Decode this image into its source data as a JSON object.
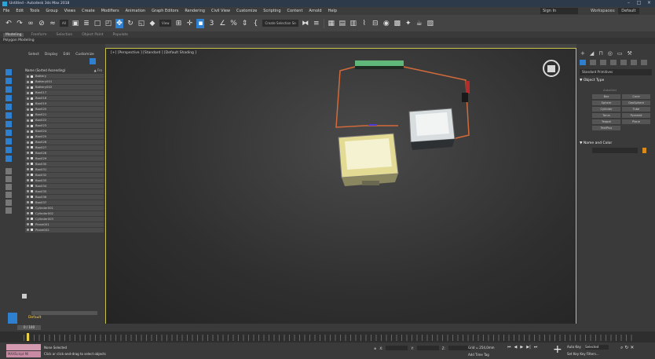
{
  "window": {
    "title": "Untitled - Autodesk 3ds Max 2018"
  },
  "menubar": {
    "items": [
      "File",
      "Edit",
      "Tools",
      "Group",
      "Views",
      "Create",
      "Modifiers",
      "Animation",
      "Graph Editors",
      "Rendering",
      "Civil View",
      "Customize",
      "Scripting",
      "Content",
      "Arnold",
      "Help"
    ],
    "signin": "Sign In",
    "workspaces_label": "Workspaces:",
    "workspaces_value": "Default"
  },
  "toolbar": {
    "filter_dd": "All",
    "view_dd": "View",
    "selection_set_dd": "Create Selection Se"
  },
  "ribbon": {
    "tabs": [
      "Modeling",
      "Freeform",
      "Selection",
      "Object Paint",
      "Populate"
    ],
    "sub_label": "Polygon Modeling"
  },
  "explorer": {
    "menu": [
      "Select",
      "Display",
      "Edit",
      "Customize"
    ],
    "header": "Name (Sorted Ascending)",
    "sort_label": "▲ Fro",
    "items": [
      "Battery",
      "Battery001",
      "Battery002",
      "Box017",
      "Box018",
      "Box019",
      "Box020",
      "Box021",
      "Box022",
      "Box023",
      "Box024",
      "Box025",
      "Box026",
      "Box027",
      "Box028",
      "Box029",
      "Box030",
      "Box031",
      "Box032",
      "Box033",
      "Box034",
      "Box035",
      "Box036",
      "Box037",
      "Cylinder001",
      "Cylinder002",
      "Cylinder003",
      "Plane001",
      "Plane002"
    ],
    "layer": "Default"
  },
  "viewport": {
    "label": "[+] [Perspective ] [Standard ] [Default Shading ]"
  },
  "command_panel": {
    "dropdown": "Standard Primitives",
    "object_type_title": "▼ Object Type",
    "autogrid": "AutoGrid",
    "primitives": [
      "Box",
      "Cone",
      "Sphere",
      "GeoSphere",
      "Cylinder",
      "Tube",
      "Torus",
      "Pyramid",
      "Teapot",
      "Plane",
      "TextPlus"
    ],
    "name_color_title": "▼ Name and Color",
    "colors": {
      "object_color": "#d88a1a"
    }
  },
  "timeline": {
    "frame": "0 / 100"
  },
  "status": {
    "selection": "None Selected",
    "prompt": "Click or click-and-drag to select objects",
    "maxscript_label": "MAXScript Mi",
    "x_label": "X:",
    "y_label": "Y:",
    "z_label": "Z:",
    "grid": "Grid = 254,0mm",
    "add_time_tag": "Add Time Tag",
    "auto_key": "Auto Key",
    "auto_key_dd": "Selected",
    "set_key": "Set Key",
    "key_filters": "Key Filters..."
  },
  "accent_colors": {
    "active_blue": "#2e7fd0",
    "viewport_border": "#c9c34b",
    "wire_orange": "#d26a3a"
  }
}
